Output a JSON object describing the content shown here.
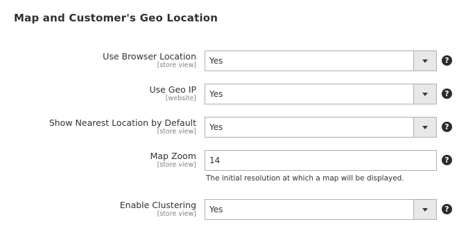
{
  "section": {
    "title": "Map and Customer's Geo Location"
  },
  "fields": [
    {
      "label": "Use Browser Location",
      "scope": "[store view]",
      "value": "Yes",
      "type": "select"
    },
    {
      "label": "Use Geo IP",
      "scope": "[website]",
      "value": "Yes",
      "type": "select"
    },
    {
      "label": "Show Nearest Location by Default",
      "scope": "[store view]",
      "value": "Yes",
      "type": "select"
    },
    {
      "label": "Map Zoom",
      "scope": "[store view]",
      "value": "14",
      "type": "text",
      "note": "The initial resolution at which a map will be displayed."
    },
    {
      "label": "Enable Clustering",
      "scope": "[store view]",
      "value": "Yes",
      "type": "select"
    }
  ],
  "icons": {
    "help": "question-mark-icon",
    "dropdown": "chevron-down-icon"
  },
  "help_glyph": "?",
  "colors": {
    "text": "#303030",
    "scope": "#808080",
    "border": "#adadad",
    "select_button_bg": "#e8e8e8",
    "help_icon_bg": "#2b2b2b"
  }
}
